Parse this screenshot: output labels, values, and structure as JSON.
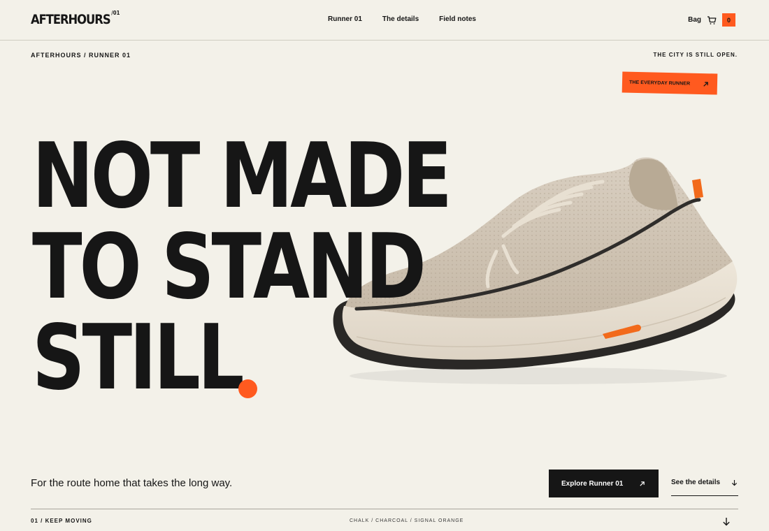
{
  "brand": {
    "name": "AFTERHOURS",
    "superscript": "/01"
  },
  "nav": {
    "items": [
      {
        "label": "Runner 01"
      },
      {
        "label": "The details"
      },
      {
        "label": "Field notes"
      }
    ]
  },
  "bag": {
    "label": "Bag",
    "count": "0",
    "icon": "shopping-bag-icon"
  },
  "breadcrumb": "AFTERHOURS / RUNNER 01",
  "tagline": "THE CITY IS STILL OPEN.",
  "sticker": {
    "label": "THE EVERYDAY RUNNER",
    "icon": "arrow-up-right-icon"
  },
  "hero": {
    "headline_lines": [
      "NOT MADE",
      "TO STAND",
      "STILL"
    ],
    "accent_dot": "orange-dot",
    "image": "beige knit running shoe with charcoal stripe and orange heel tab"
  },
  "lede": "For the route home that takes the long way.",
  "actions": {
    "primary": {
      "label": "Explore Runner 01",
      "icon": "arrow-up-right-icon"
    },
    "secondary": {
      "label": "See the details",
      "icon": "arrow-down-icon"
    }
  },
  "footer": {
    "left": "01 / KEEP MOVING",
    "colors": "CHALK / CHARCOAL / SIGNAL ORANGE",
    "scroll_icon": "arrow-down-icon"
  },
  "colors": {
    "background": "#f3f1e9",
    "ink": "#161616",
    "accent": "#ff5a1f"
  }
}
